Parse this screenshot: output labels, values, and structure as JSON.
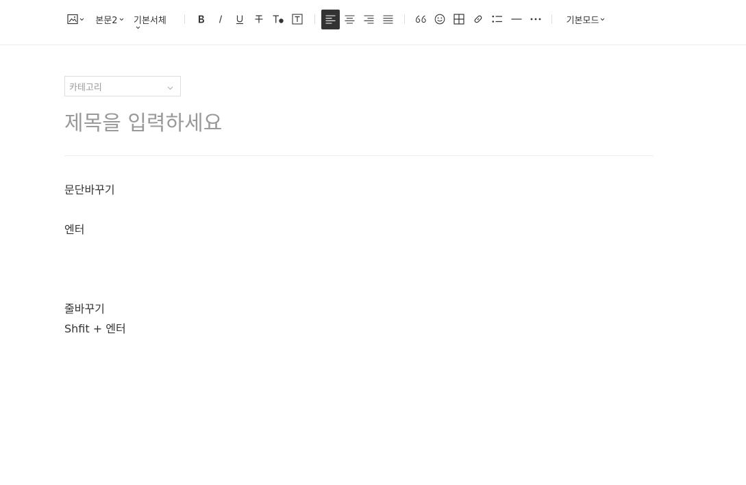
{
  "toolbar": {
    "image_icon": "image-icon",
    "paragraph_style": "본문2",
    "font_family": "기본서체",
    "bold_icon": "bold-icon",
    "italic_icon": "italic-icon",
    "underline_icon": "underline-icon",
    "strikethrough_icon": "strikethrough-icon",
    "text_color_icon": "text-color-icon",
    "text_background_icon": "text-background-icon",
    "align_options": [
      "align-left-icon",
      "align-center-icon",
      "align-right-icon",
      "align-justify-icon"
    ],
    "active_align": "align-left-icon",
    "quote_icon": "quote-icon",
    "emoji_icon": "emoji-icon",
    "table_icon": "table-icon",
    "link_icon": "link-icon",
    "list_icon": "list-icon",
    "divider_icon": "horizontal-line-icon",
    "more_icon": "more-icon",
    "mode": "기본모드",
    "active_color": "#333333"
  },
  "post": {
    "category_placeholder": "카테고리",
    "title_placeholder": "제목을 입력하세요",
    "body": {
      "p1": "문단바꾸기",
      "p2": "엔터",
      "p3": "줄바꾸기",
      "p4": "Shfit + 엔터"
    }
  }
}
